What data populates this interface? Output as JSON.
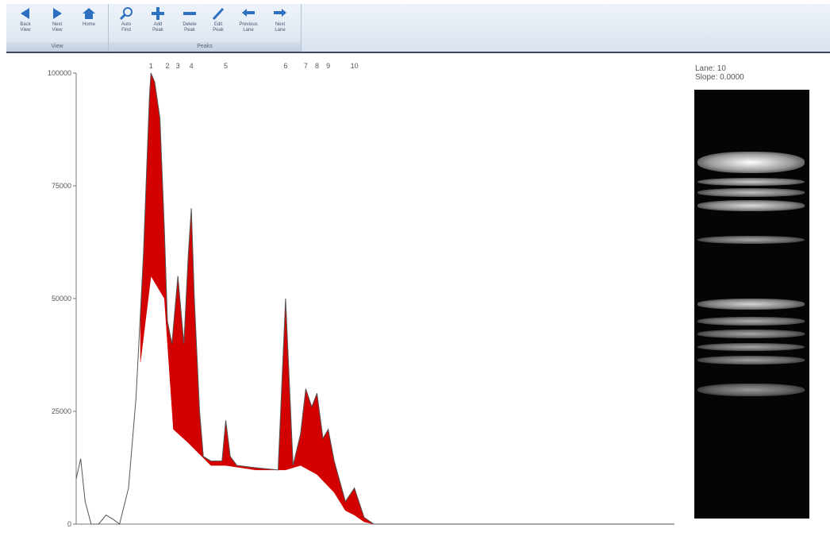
{
  "toolbar": {
    "groups": [
      {
        "label": "View",
        "buttons": [
          {
            "label": "Back\nView",
            "icon": "arrow-left-icon"
          },
          {
            "label": "Next\nView",
            "icon": "arrow-right-icon"
          },
          {
            "label": "Home",
            "icon": "home-icon"
          }
        ]
      },
      {
        "label": "Peaks",
        "buttons": [
          {
            "label": "Auto\nFind",
            "icon": "magnifier-icon"
          },
          {
            "label": "Add\nPeak",
            "icon": "plus-icon"
          },
          {
            "label": "Delete\nPeak",
            "icon": "minus-icon"
          },
          {
            "label": "Edit\nPeak",
            "icon": "pencil-icon"
          },
          {
            "label": "Previous\nLane",
            "icon": "arrow-back-icon"
          },
          {
            "label": "Next\nLane",
            "icon": "arrow-forward-icon"
          }
        ]
      }
    ]
  },
  "lane_info": {
    "lane": "Lane: 10",
    "slope": "Slope: 0.0000"
  },
  "chart_data": {
    "type": "area",
    "ylim": [
      0,
      100000
    ],
    "yticks": [
      {
        "value": 0,
        "label": "0"
      },
      {
        "value": 25000,
        "label": "25000"
      },
      {
        "value": 50000,
        "label": "50000"
      },
      {
        "value": 75000,
        "label": "75000"
      },
      {
        "value": 100000,
        "label": "100000"
      }
    ],
    "peak_labels": [
      "1",
      "2",
      "3",
      "4",
      "5",
      "6",
      "7",
      "8",
      "9",
      "10"
    ],
    "xlim": [
      0,
      800
    ],
    "profile": [
      [
        0,
        10000
      ],
      [
        6,
        14500
      ],
      [
        12,
        5000
      ],
      [
        20,
        0
      ],
      [
        30,
        0
      ],
      [
        40,
        2000
      ],
      [
        50,
        1000
      ],
      [
        58,
        0
      ],
      [
        70,
        8000
      ],
      [
        80,
        28000
      ],
      [
        90,
        60000
      ],
      [
        95,
        82000
      ],
      [
        98,
        95000
      ],
      [
        100,
        100000
      ],
      [
        105,
        98000
      ],
      [
        112,
        90000
      ],
      [
        118,
        65000
      ],
      [
        122,
        45000
      ],
      [
        128,
        40000
      ],
      [
        136,
        55000
      ],
      [
        144,
        40000
      ],
      [
        150,
        60000
      ],
      [
        154,
        70000
      ],
      [
        158,
        50000
      ],
      [
        165,
        25000
      ],
      [
        170,
        15000
      ],
      [
        180,
        14000
      ],
      [
        195,
        14000
      ],
      [
        200,
        23000
      ],
      [
        206,
        15000
      ],
      [
        215,
        13000
      ],
      [
        240,
        12500
      ],
      [
        270,
        12000
      ],
      [
        280,
        50000
      ],
      [
        290,
        13000
      ],
      [
        300,
        20000
      ],
      [
        307,
        30000
      ],
      [
        315,
        26000
      ],
      [
        322,
        29000
      ],
      [
        330,
        19000
      ],
      [
        337,
        21000
      ],
      [
        345,
        14000
      ],
      [
        360,
        5000
      ],
      [
        372,
        8000
      ],
      [
        385,
        1500
      ],
      [
        398,
        0
      ],
      [
        800,
        0
      ]
    ],
    "baseline": [
      [
        86,
        36000
      ],
      [
        100,
        55000
      ],
      [
        118,
        50000
      ],
      [
        130,
        21000
      ],
      [
        150,
        18000
      ],
      [
        168,
        15000
      ],
      [
        180,
        13000
      ],
      [
        200,
        13000
      ],
      [
        220,
        12500
      ],
      [
        240,
        12000
      ],
      [
        280,
        12000
      ],
      [
        300,
        13000
      ],
      [
        322,
        11000
      ],
      [
        345,
        7000
      ],
      [
        360,
        3000
      ],
      [
        372,
        2000
      ],
      [
        385,
        500
      ],
      [
        398,
        0
      ]
    ],
    "peaks": [
      {
        "label": "1",
        "x": 100,
        "y": 100000
      },
      {
        "label": "2",
        "x": 122,
        "y": 55000
      },
      {
        "label": "3",
        "x": 136,
        "y": 46000
      },
      {
        "label": "4",
        "x": 154,
        "y": 70000
      },
      {
        "label": "5",
        "x": 200,
        "y": 31000
      },
      {
        "label": "6",
        "x": 280,
        "y": 52000
      },
      {
        "label": "7",
        "x": 307,
        "y": 30000
      },
      {
        "label": "8",
        "x": 322,
        "y": 27000
      },
      {
        "label": "9",
        "x": 337,
        "y": 21000
      },
      {
        "label": "10",
        "x": 372,
        "y": 12000
      }
    ],
    "fill_color": "#d30000",
    "line_color": "#555555"
  },
  "gel_bands": [
    {
      "pos": 0.17,
      "intensity": 1.0,
      "thickness": 0.05
    },
    {
      "pos": 0.215,
      "intensity": 0.6,
      "thickness": 0.02
    },
    {
      "pos": 0.24,
      "intensity": 0.55,
      "thickness": 0.02
    },
    {
      "pos": 0.27,
      "intensity": 0.75,
      "thickness": 0.025
    },
    {
      "pos": 0.35,
      "intensity": 0.35,
      "thickness": 0.02
    },
    {
      "pos": 0.5,
      "intensity": 0.7,
      "thickness": 0.025
    },
    {
      "pos": 0.54,
      "intensity": 0.4,
      "thickness": 0.02
    },
    {
      "pos": 0.57,
      "intensity": 0.35,
      "thickness": 0.02
    },
    {
      "pos": 0.6,
      "intensity": 0.35,
      "thickness": 0.02
    },
    {
      "pos": 0.63,
      "intensity": 0.3,
      "thickness": 0.02
    },
    {
      "pos": 0.7,
      "intensity": 0.25,
      "thickness": 0.03
    }
  ]
}
